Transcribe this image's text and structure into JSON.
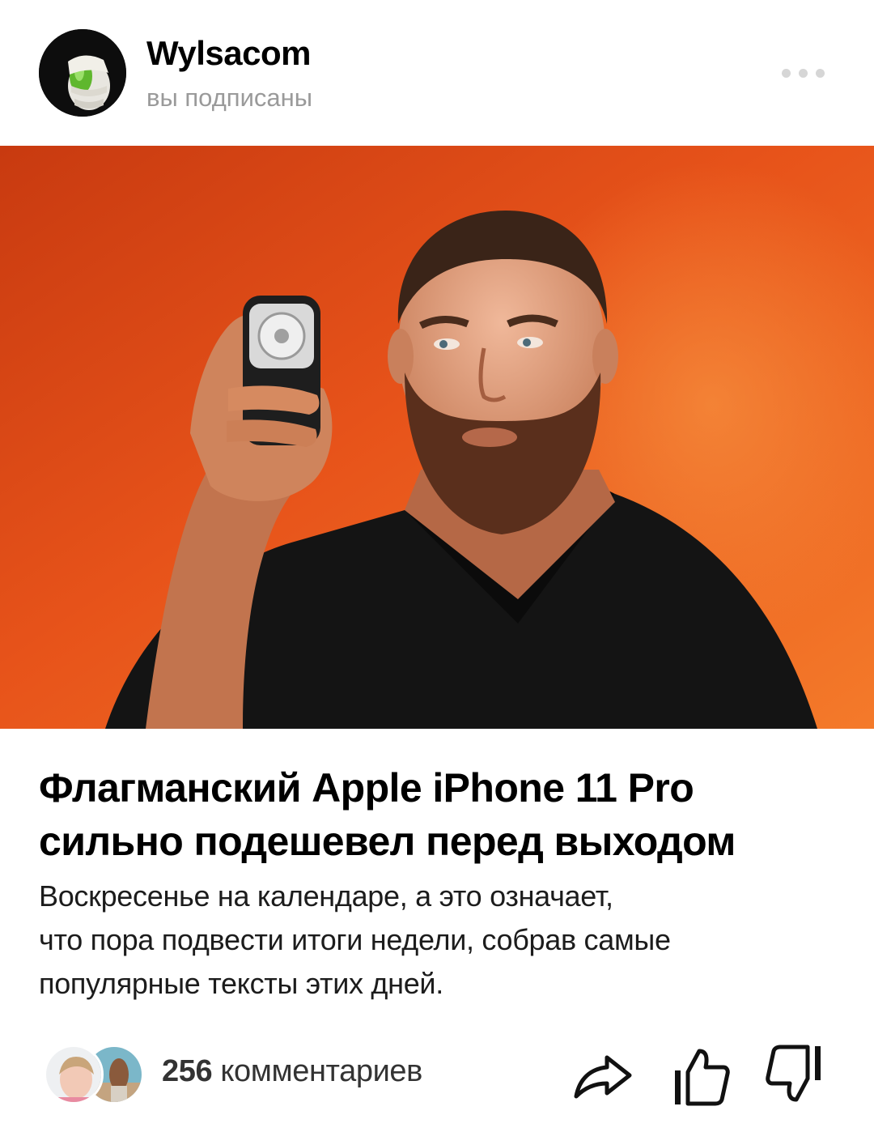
{
  "channel": {
    "name": "Wylsacom",
    "status": "вы подписаны"
  },
  "article": {
    "title_line1": "Флагманский Apple iPhone 11 Pro",
    "title_line2": "сильно подешевел перед выходом",
    "snippet_line1": "Воскресенье на календаре, а это означает,",
    "snippet_line2": "что пора подвести итоги недели, собрав самые",
    "snippet_line3": "популярные тексты этих дней."
  },
  "footer": {
    "comments_number": "256",
    "comments_label": "комментариев"
  },
  "icons": {
    "more": "more-dots-icon",
    "share": "share-icon",
    "like": "thumbs-up-icon",
    "dislike": "thumbs-down-icon"
  },
  "colors": {
    "hero_background": "#e6551c",
    "muted_text": "#9a9a9a",
    "more_dots": "#d6d6d6"
  }
}
